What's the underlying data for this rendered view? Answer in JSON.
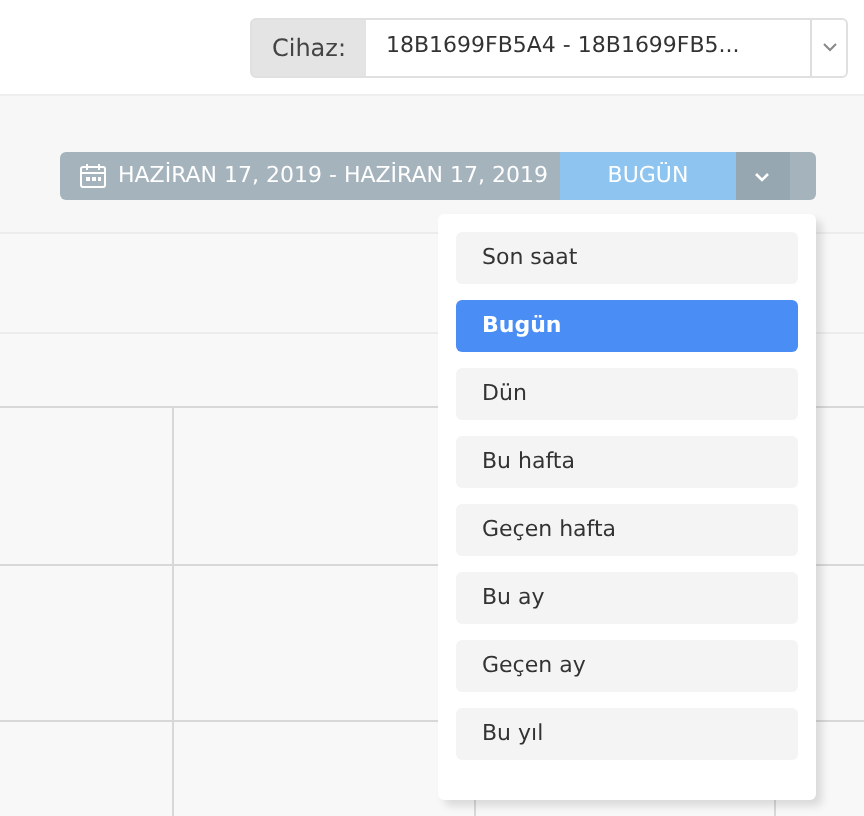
{
  "device_selector": {
    "label": "Cihaz:",
    "value": "18B1699FB5A4 - 18B1699FB5..."
  },
  "date_range": {
    "range": "HAZİRAN 17, 2019 - HAZİRAN 17, 2019",
    "preset": "BUGÜN",
    "expanded": true
  },
  "presets": [
    {
      "label": "Son saat",
      "selected": false
    },
    {
      "label": "Bugün",
      "selected": true
    },
    {
      "label": "Dün",
      "selected": false
    },
    {
      "label": "Bu hafta",
      "selected": false
    },
    {
      "label": "Geçen hafta",
      "selected": false
    },
    {
      "label": "Bu ay",
      "selected": false
    },
    {
      "label": "Geçen ay",
      "selected": false
    },
    {
      "label": "Bu yıl",
      "selected": false
    }
  ]
}
